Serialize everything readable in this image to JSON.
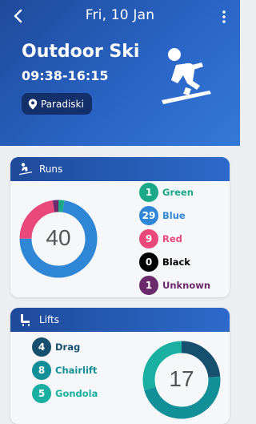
{
  "header": {
    "date": "Fri, 10 Jan",
    "activity": "Outdoor Ski",
    "time_range": "09:38-16:15",
    "location": "Paradiski",
    "background_color": "#2a66c8"
  },
  "runs": {
    "title": "Runs",
    "total": "40",
    "items": [
      {
        "count": "1",
        "label": "Green",
        "color": "#1aa889",
        "text_color": "#1aa889"
      },
      {
        "count": "29",
        "label": "Blue",
        "color": "#2f86d6",
        "text_color": "#2f86d6"
      },
      {
        "count": "9",
        "label": "Red",
        "color": "#e8497a",
        "text_color": "#e8497a"
      },
      {
        "count": "0",
        "label": "Black",
        "color": "#000000",
        "text_color": "#000000"
      },
      {
        "count": "1",
        "label": "Unknown",
        "color": "#6b2a6b",
        "text_color": "#6b2a6b"
      }
    ]
  },
  "lifts": {
    "title": "Lifts",
    "total": "17",
    "items": [
      {
        "count": "4",
        "label": "Drag",
        "color": "#174f6e",
        "text_color": "#174f6e"
      },
      {
        "count": "8",
        "label": "Chairlift",
        "color": "#138f97",
        "text_color": "#138f97"
      },
      {
        "count": "5",
        "label": "Gondola",
        "color": "#19b0a1",
        "text_color": "#19b0a1"
      }
    ]
  }
}
